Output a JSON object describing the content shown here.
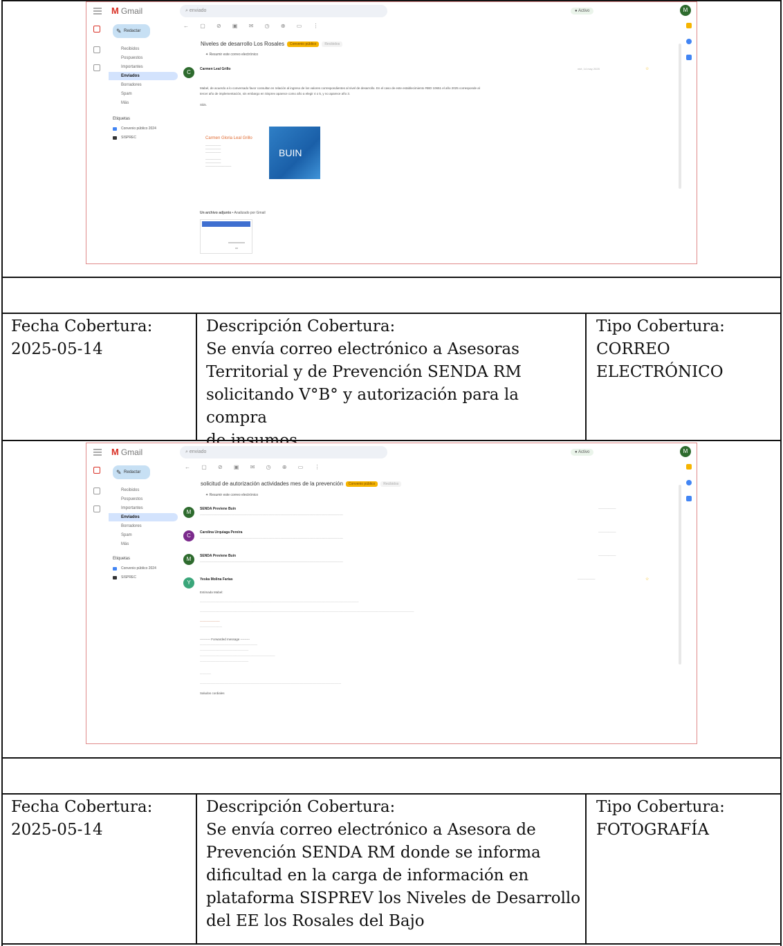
{
  "rows": [
    {
      "fecha_label": "Fecha Cobertura:",
      "fecha": "2025-05-14",
      "descripcion_label": "Descripción Cobertura:",
      "descripcion_lines": [
        "Se envía correo electrónico a Asesoras",
        "Territorial y de Prevención SENDA RM",
        "solicitando V°B° y autorización para la compra",
        "de insumos"
      ],
      "tipo_label": "Tipo Cobertura:",
      "tipo_lines": [
        "CORREO",
        "ELECTRÓNICO"
      ]
    },
    {
      "fecha_label": "Fecha Cobertura:",
      "fecha": "2025-05-14",
      "descripcion_label": "Descripción Cobertura:",
      "descripcion_lines": [
        "Se envía correo electrónico a Asesora de",
        "Prevención SENDA RM donde se informa",
        "dificultad en la carga de información en",
        "plataforma SISPREV los Niveles de Desarrollo",
        "del EE los Rosales del Bajo"
      ],
      "tipo_label": "Tipo Cobertura:",
      "tipo_lines": [
        "FOTOGRAFÍA"
      ]
    }
  ],
  "screenshot1": {
    "app": "Gmail",
    "search": "enviado",
    "active": "Activo",
    "compose": "Redactar",
    "folders": [
      "Recibidos",
      "Pospuestos",
      "Importantes",
      "Enviados",
      "Borradores",
      "Spam",
      "Más"
    ],
    "labels_header": "Etiquetas",
    "labels": [
      "Convenio público 2024",
      "SISPREC"
    ],
    "subject": "Niveles de desarrollo Los Rosales",
    "summary": "Resumir este correo electrónico",
    "sender": "Carmen Leal Grillo",
    "sender_initial": "C",
    "body_lines": [
      "Mabel, de acuerdo a lo conversado favor consultar en relación al ingreso de los valores correspondientes al nivel de desarrollo. En el caso de este establecimiento RBD 10651 el año 2025 corresponde al",
      "tercer año de implementación, sin embargo en Sisprev aparece como año a elegir 4 o 5, y no aparece año 3."
    ],
    "closing": "Slds.",
    "signature_name": "Carmen Gloria Leal Grillo",
    "signature_logo": "BUIN",
    "attachment_header": "Un archivo adjunto",
    "attachment_note": "Analizado por Gmail"
  },
  "screenshot2": {
    "app": "Gmail",
    "search": "enviado",
    "active": "Activo",
    "compose": "Redactar",
    "folders": [
      "Recibidos",
      "Pospuestos",
      "Importantes",
      "Enviados",
      "Borradores",
      "Spam",
      "Más"
    ],
    "labels_header": "Etiquetas",
    "labels": [
      "Convenio público 2024",
      "SISPREC"
    ],
    "subject": "solicitud de autorización actividades mes de la prevención",
    "summary": "Resumir este correo electrónico",
    "messages": [
      {
        "sender": "SENDA Previene Buin",
        "initial": "M",
        "color": "#2e6b2e"
      },
      {
        "sender": "Carolina Urquiaga Pereira",
        "initial": "C",
        "color": "#7b2a8c"
      },
      {
        "sender": "SENDA Previene Buin",
        "initial": "M",
        "color": "#2e6b2e"
      },
      {
        "sender": "Yeska Molina Farias",
        "initial": "Y",
        "color": "#3aa67a"
      }
    ],
    "body_greeting": "Estimada Mabel:",
    "forwarded": "---------- Forwarded message ---------",
    "closing": "Saludos cordiales"
  }
}
